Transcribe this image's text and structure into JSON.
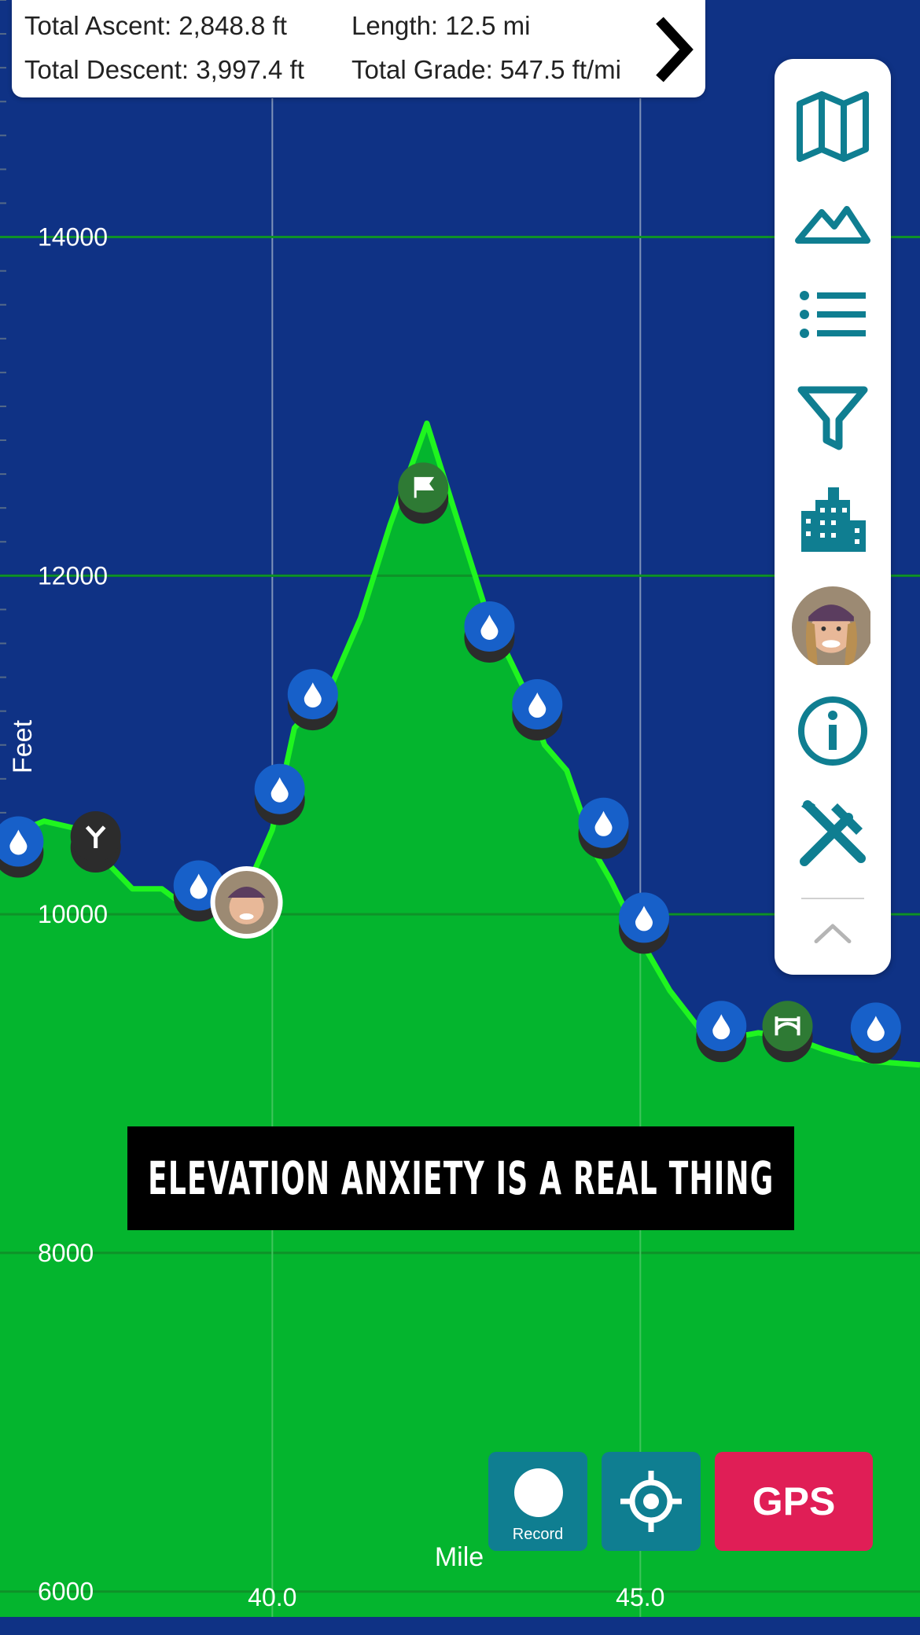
{
  "stats": {
    "ascent": "Total Ascent: 2,848.8 ft",
    "length": "Length: 12.5 mi",
    "descent": "Total Descent: 3,997.4 ft",
    "grade": "Total Grade: 547.5 ft/mi"
  },
  "toolbar": {
    "items": [
      "map-icon",
      "mountain-icon",
      "list-icon",
      "filter-icon",
      "buildings-icon",
      "avatar",
      "info-icon",
      "tools-icon",
      "chevron-up-icon"
    ]
  },
  "caption": "ELEVATION ANXIETY IS A REAL THING",
  "buttons": {
    "record": "Record",
    "gps": "GPS"
  },
  "colors": {
    "background": "#0f3285",
    "fill": "#04b52e",
    "line": "#1ff51f",
    "accent": "#0f7e91",
    "gps": "#e01e56",
    "water_marker": "#1760c9",
    "green_marker": "#2e7a34"
  },
  "chart_data": {
    "type": "area",
    "xlabel": "Mile",
    "ylabel": "Feet",
    "xlim": [
      36.3,
      48.8
    ],
    "ylim": [
      5850,
      15400
    ],
    "yticks": [
      6000,
      8000,
      10000,
      12000,
      14000
    ],
    "yticklabels": [
      "6000",
      "8000",
      "10000",
      "12000",
      "14000"
    ],
    "xticks": [
      40,
      45
    ],
    "xticklabels": [
      "40.0",
      "45.0"
    ],
    "grid": true,
    "series": [
      {
        "x": [
          36.3,
          36.5,
          36.9,
          37.3,
          38.1,
          38.5,
          38.9,
          39.2,
          39.6,
          40.0,
          40.3,
          40.8,
          41.2,
          41.6,
          42.1,
          42.5,
          42.9,
          43.4,
          43.7,
          44.0,
          44.4,
          44.6,
          45.0,
          45.4,
          45.9,
          46.1,
          46.6,
          47.0,
          47.5,
          47.9,
          48.2,
          48.5,
          48.8
        ],
        "y": [
          10450,
          10480,
          10550,
          10510,
          10150,
          10150,
          10020,
          10080,
          10100,
          10500,
          11100,
          11350,
          11750,
          12300,
          12900,
          12350,
          11800,
          11350,
          11000,
          10850,
          10350,
          10200,
          9850,
          9550,
          9270,
          9260,
          9300,
          9280,
          9200,
          9150,
          9130,
          9120,
          9110
        ]
      }
    ],
    "markers": [
      {
        "type": "water",
        "x": 36.55,
        "y": 10430
      },
      {
        "type": "junction",
        "x": 37.6,
        "y": 10460
      },
      {
        "type": "water",
        "x": 39.0,
        "y": 10170
      },
      {
        "type": "avatar",
        "x": 39.65,
        "y": 10070
      },
      {
        "type": "water",
        "x": 40.1,
        "y": 10740
      },
      {
        "type": "water",
        "x": 40.55,
        "y": 11300
      },
      {
        "type": "summit",
        "x": 42.05,
        "y": 12520
      },
      {
        "type": "water",
        "x": 42.95,
        "y": 11700
      },
      {
        "type": "water",
        "x": 43.6,
        "y": 11240
      },
      {
        "type": "water",
        "x": 44.5,
        "y": 10540
      },
      {
        "type": "water",
        "x": 45.05,
        "y": 9980
      },
      {
        "type": "water",
        "x": 46.1,
        "y": 9340
      },
      {
        "type": "bridge",
        "x": 47.0,
        "y": 9340
      },
      {
        "type": "water",
        "x": 48.2,
        "y": 9330
      }
    ]
  }
}
